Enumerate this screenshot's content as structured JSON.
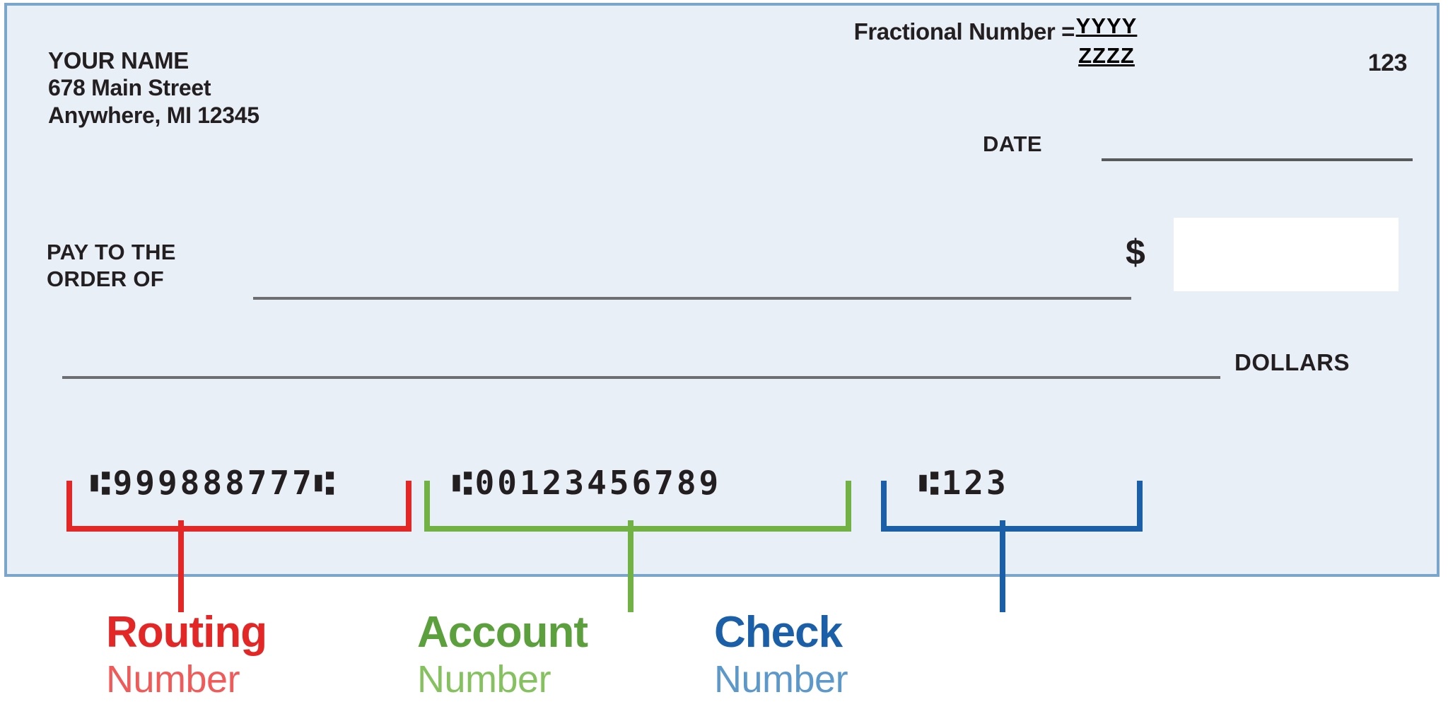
{
  "check": {
    "background_color": "#e9eff7",
    "border_color": "#7aa6cd",
    "payer": {
      "name": "YOUR NAME",
      "street": "678 Main Street",
      "city_state_zip": "Anywhere, MI  12345"
    },
    "fractional": {
      "label": "Fractional Number =",
      "numerator": "YYYY",
      "denominator": "ZZZZ"
    },
    "check_number_top_right": "123",
    "date_label": "DATE",
    "date_value": "",
    "pay_to": {
      "line1": "PAY TO THE",
      "line2": "ORDER OF",
      "value": ""
    },
    "amount": {
      "currency_symbol": "$",
      "value": ""
    },
    "dollars_label": "DOLLARS",
    "dollars_written_value": "",
    "micr": {
      "routing": "⑆999888777⑆",
      "account": "⑆00123456789",
      "check_number": "⑆123"
    }
  },
  "legend": {
    "routing": {
      "title": "Routing",
      "subtitle": "Number",
      "color": "#e32726",
      "subtitle_color": "#f05a58"
    },
    "account": {
      "title": "Account",
      "subtitle": "Number",
      "color": "#5ba03c",
      "subtitle_color": "#85c25f"
    },
    "check_number": {
      "title": "Check",
      "subtitle": "Number",
      "color": "#1b5fa8",
      "subtitle_color": "#5d98cb"
    }
  }
}
